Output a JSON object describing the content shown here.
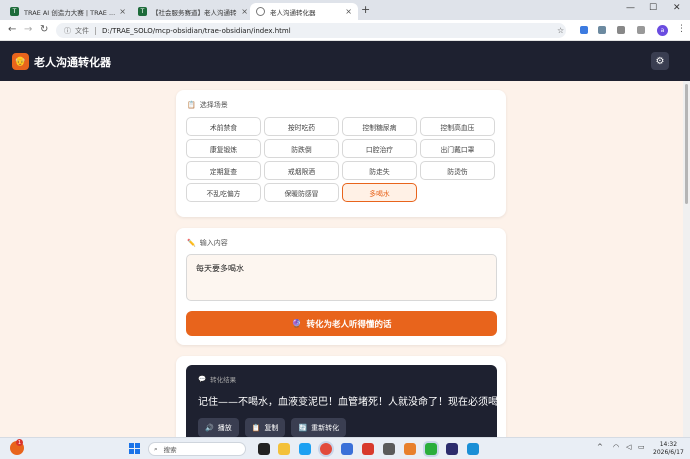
{
  "browser": {
    "tabs": [
      {
        "label": "TRAE AI 创造力大赛 | TRAE ..."
      },
      {
        "label": "【社会服务赛道】老人沟通转化..."
      },
      {
        "label": "老人沟通转化器"
      }
    ],
    "new_tab": "+",
    "address": {
      "scheme_label": "文件",
      "url": "D:/TRAE_SOLO/mcp-obsidian/trae-obsidian/index.html"
    },
    "profile_initial": "a"
  },
  "app": {
    "title": "老人沟通转化器",
    "logo_emoji": "👴",
    "settings_icon": "⚙"
  },
  "scenario_card": {
    "heading_icon": "📋",
    "heading": "选择场景",
    "chips": [
      "术前禁食",
      "按时吃药",
      "控制糖尿病",
      "控制高血压",
      "康复锻炼",
      "防跌倒",
      "口腔治疗",
      "出门戴口罩",
      "定期复查",
      "戒烟限酒",
      "防走失",
      "防烫伤",
      "不乱吃偏方",
      "保暖防感冒",
      "多喝水"
    ],
    "selected_index": 14
  },
  "input_card": {
    "heading_icon": "✏️",
    "heading": "输入内容",
    "value": "每天要多喝水",
    "convert_icon": "🔮",
    "convert_label": "转化为老人听得懂的话"
  },
  "result_card": {
    "heading_icon": "💬",
    "heading": "转化结果",
    "text": "记住——不喝水，血液变泥巴！血管堵死！人就没命了！现在必须喝！",
    "buttons": [
      {
        "icon": "🔊",
        "label": "播放"
      },
      {
        "icon": "📋",
        "label": "复制"
      },
      {
        "icon": "🔄",
        "label": "重新转化"
      }
    ]
  },
  "taskbar": {
    "weather_badge": "1",
    "search_placeholder": "搜索",
    "clock_time": "14:32",
    "clock_date": "2026/6/17"
  },
  "colors": {
    "accent": "#e8641c",
    "header_bg": "#1e2130",
    "page_bg": "#fdf2ea"
  }
}
